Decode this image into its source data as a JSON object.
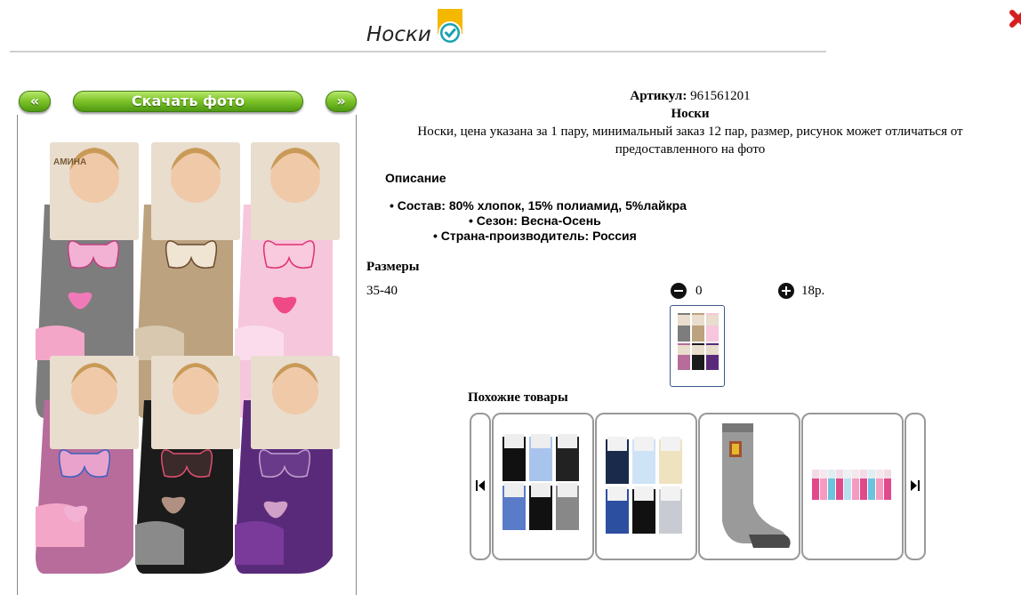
{
  "header": {
    "title": "Носки"
  },
  "left_panel": {
    "prev_label": "«",
    "download_label": "Скачать фото",
    "next_label": "»",
    "photo_brand": "АМИНА"
  },
  "product": {
    "article_label": "Артикул:",
    "article_value": "961561201",
    "name": "Носки",
    "summary_line1": "Носки, цена указана за 1 пару, минимальный заказ 12 пар, размер, рисунок может отличаться от",
    "summary_line2": "предоставленного на фото",
    "description_title": "Описание",
    "bullets": [
      "• Состав: 80% хлопок, 15% полиамид, 5%лайкра",
      "• Сезон: Весна-Осень",
      "• Страна-производитель: Россия"
    ]
  },
  "sizes": {
    "title": "Размеры",
    "rows": [
      {
        "size": "35-40",
        "quantity": "0",
        "price": "18р."
      }
    ]
  },
  "similar": {
    "title": "Похожие товары"
  },
  "colors": {
    "accent_green": "#7fc52a",
    "close_red": "#d62020",
    "badge_yellow": "#f5b800",
    "badge_teal": "#17a2b0"
  },
  "icons": {
    "minus": "minus-circle-icon",
    "plus": "plus-circle-icon",
    "prev": "skip-back-icon",
    "next": "skip-forward-icon",
    "close": "close-icon",
    "check": "verified-check-icon"
  }
}
